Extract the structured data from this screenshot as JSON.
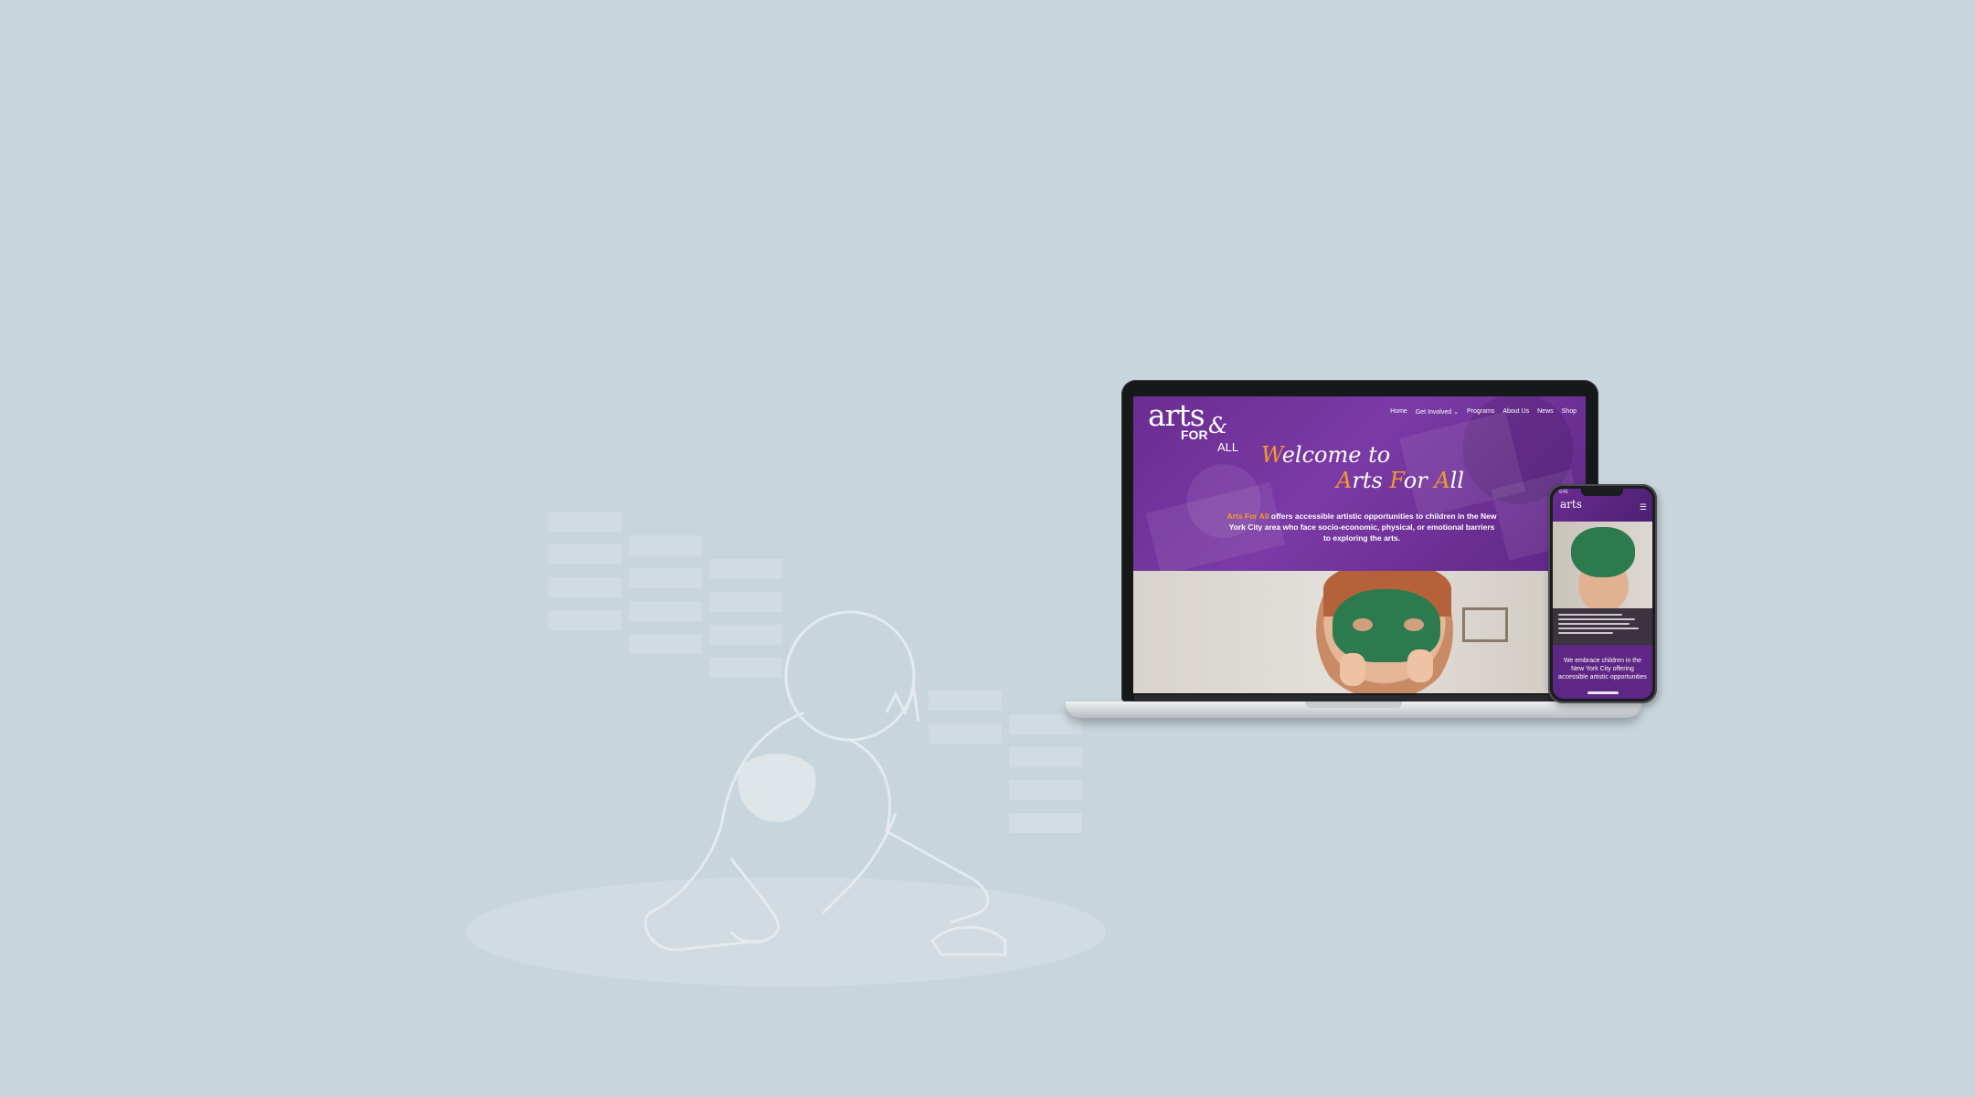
{
  "site": {
    "logo": {
      "arts": "arts",
      "for": "FOR",
      "amp": "&",
      "all": "ALL"
    },
    "nav": [
      "Home",
      "Get Involved",
      "Programs",
      "About Us",
      "News",
      "Shop"
    ],
    "nav_dropdown_indicator": "⌄",
    "hero": {
      "title_line1_initial": "W",
      "title_line1_rest": "elcome to",
      "title_line2": [
        {
          "initial": "A",
          "rest": "rts "
        },
        {
          "initial": "F",
          "rest": "or "
        },
        {
          "initial": "A",
          "rest": "ll"
        }
      ],
      "desc_highlight": "Arts For All",
      "desc_rest": " offers accessible artistic opportunities to children in the New York City area who face socio-economic, physical, or emotional barriers to exploring the arts."
    },
    "colors": {
      "purple": "#6a2d92",
      "accent": "#f39a2b",
      "background": "#c9d5dc"
    }
  },
  "phone": {
    "status_time": "9:41",
    "logo": "arts",
    "menu_icon": "hamburger-icon",
    "caption": "We embrace children in the New York City offering accessible artistic opportunities"
  }
}
